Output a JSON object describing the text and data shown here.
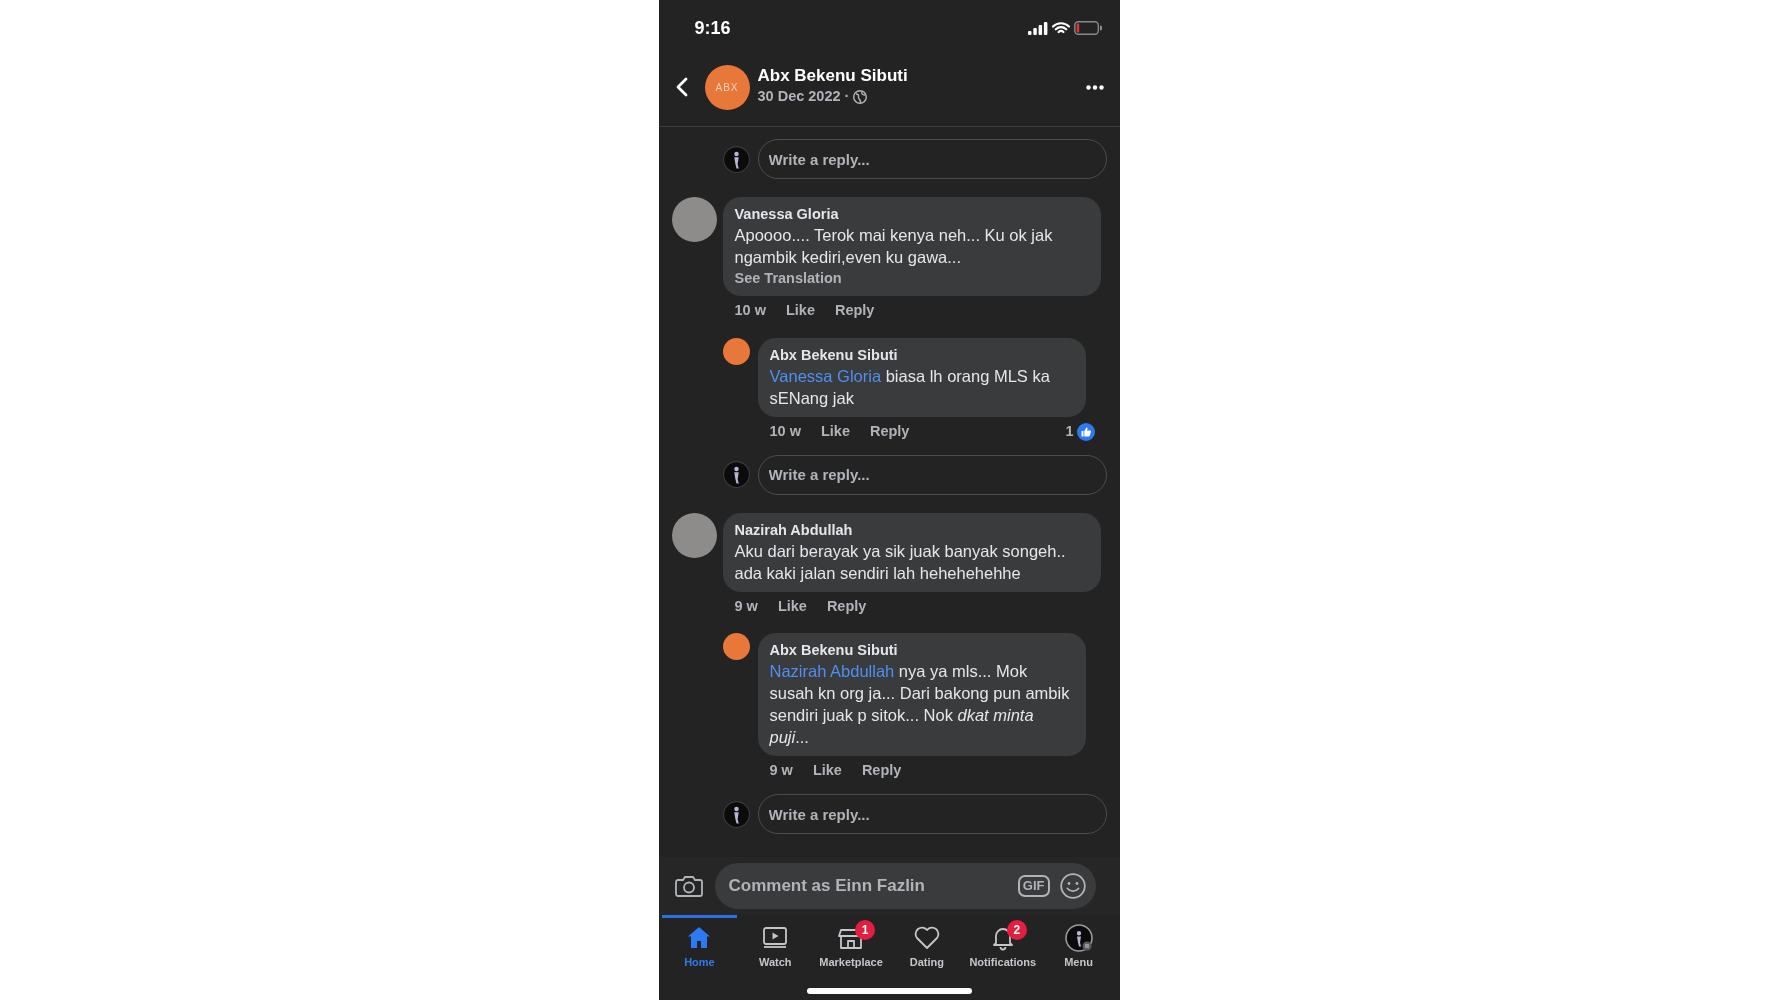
{
  "status_bar": {
    "time": "9:16"
  },
  "header": {
    "logo_text": "ABX",
    "title": "Abx Bekenu Sibuti",
    "date": "30 Dec 2022 ·"
  },
  "thread": [
    {
      "kind": "reply_box",
      "placeholder": "Write a reply..."
    },
    {
      "kind": "comment",
      "author": "Vanessa Gloria",
      "text": "Apoooo.... Terok mai kenya neh... Ku ok jak ngambik kediri,even ku gawa...",
      "see_translation": "See Translation",
      "time": "10 w",
      "actions": [
        "Like",
        "Reply"
      ],
      "replies": [
        {
          "kind": "page_comment",
          "author": "Abx Bekenu Sibuti",
          "mention": "Vanessa Gloria",
          "text": "biasa lh orang MLS ka sENang jak",
          "time": "10 w",
          "actions": [
            "Like",
            "Reply"
          ],
          "like_count": "1"
        },
        {
          "kind": "reply_box",
          "placeholder": "Write a reply..."
        }
      ]
    },
    {
      "kind": "comment",
      "author": "Nazirah Abdullah",
      "text": "Aku dari berayak ya sik juak banyak songeh.. ada kaki jalan sendiri lah hehehehehhe",
      "time": "9 w",
      "actions": [
        "Like",
        "Reply"
      ],
      "replies": [
        {
          "kind": "page_comment",
          "author": "Abx Bekenu Sibuti",
          "mention": "Nazirah Abdullah",
          "text": "nya ya mls... Mok susah kn org ja... Dari bakong pun ambik sendiri juak p sitok... Nok *dkat minta puji*...",
          "time": "9 w",
          "actions": [
            "Like",
            "Reply"
          ]
        },
        {
          "kind": "reply_box",
          "placeholder": "Write a reply..."
        }
      ]
    }
  ],
  "comment_bar": {
    "placeholder": "Comment as Einn Fazlin",
    "gif_label": "GIF"
  },
  "nav": [
    {
      "kind": "home",
      "label": "Home",
      "selected": true
    },
    {
      "kind": "video",
      "label": "Watch",
      "selected": false
    },
    {
      "kind": "shop",
      "label": "Marketplace",
      "selected": false,
      "badge": "1"
    },
    {
      "kind": "heart",
      "label": "Dating",
      "selected": false
    },
    {
      "kind": "bell",
      "label": "Notifications",
      "selected": false,
      "badge": "2"
    },
    {
      "kind": "avatar",
      "label": "Menu",
      "selected": false
    }
  ]
}
